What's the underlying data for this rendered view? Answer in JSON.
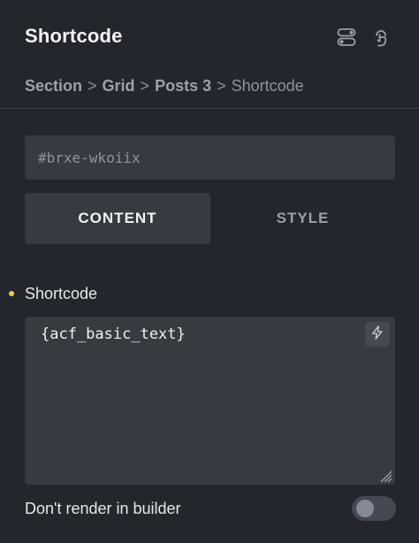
{
  "panel": {
    "title": "Shortcode"
  },
  "header_icons": [
    {
      "name": "layout-toggle-icon"
    },
    {
      "name": "pointer-inspect-icon"
    }
  ],
  "breadcrumb": {
    "items": [
      "Section",
      "Grid",
      "Posts 3"
    ],
    "separator": ">",
    "current": "Shortcode"
  },
  "element_id": {
    "placeholder": "#brxe-wkoiix"
  },
  "tabs": [
    {
      "label": "CONTENT",
      "active": true
    },
    {
      "label": "STYLE",
      "active": false
    }
  ],
  "shortcode_field": {
    "label": "Shortcode",
    "value": "{acf_basic_text}",
    "indicator_color": "#f2c94c",
    "dynamic_icon": "bolt-icon"
  },
  "render_toggle": {
    "label": "Don't render in builder",
    "enabled": false
  },
  "colors": {
    "background": "#23262c",
    "field": "#363a41",
    "accent_dot": "#f2c94c"
  }
}
